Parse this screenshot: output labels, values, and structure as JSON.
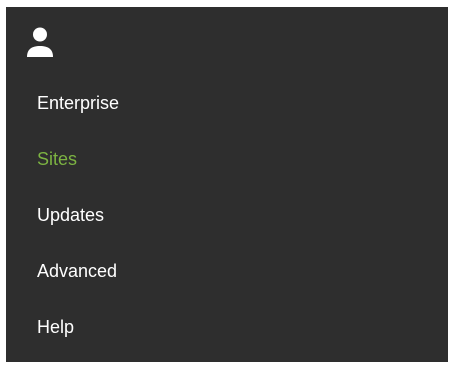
{
  "menu": {
    "user_icon": "person-icon",
    "active_color": "#7cb342",
    "background_color": "#2e2e2e",
    "items": [
      {
        "label": "Enterprise",
        "active": false
      },
      {
        "label": "Sites",
        "active": true
      },
      {
        "label": "Updates",
        "active": false
      },
      {
        "label": "Advanced",
        "active": false
      },
      {
        "label": "Help",
        "active": false
      }
    ]
  }
}
